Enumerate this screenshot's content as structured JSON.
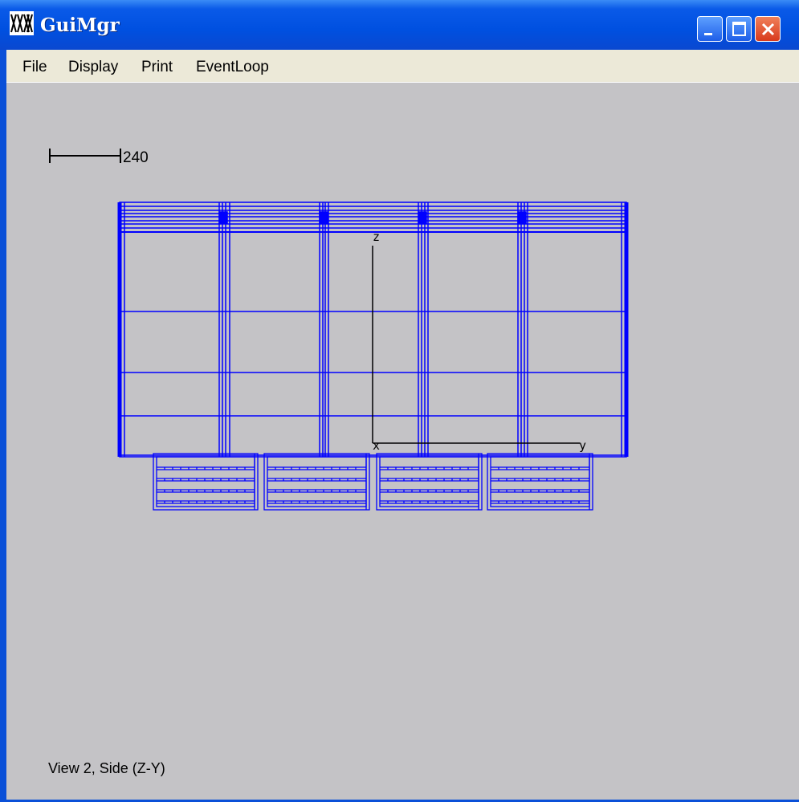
{
  "window": {
    "title": "GuiMgr",
    "icon": "app-icon",
    "controls": [
      "minimize-icon",
      "maximize-icon",
      "close-icon"
    ]
  },
  "menu": {
    "items": [
      {
        "label": "File"
      },
      {
        "label": "Display"
      },
      {
        "label": "Print"
      },
      {
        "label": "EventLoop"
      }
    ]
  },
  "view": {
    "scale_label": "240",
    "axis_z": "z",
    "axis_x": "x",
    "axis_y": "y",
    "status": "View 2, Side (Z-Y)",
    "colors": {
      "background": "#c4c3c6",
      "wireframe": "#0000ff",
      "axes": "#000000",
      "titlebar": "#0a50d8",
      "menubar": "#ece9d8"
    }
  }
}
